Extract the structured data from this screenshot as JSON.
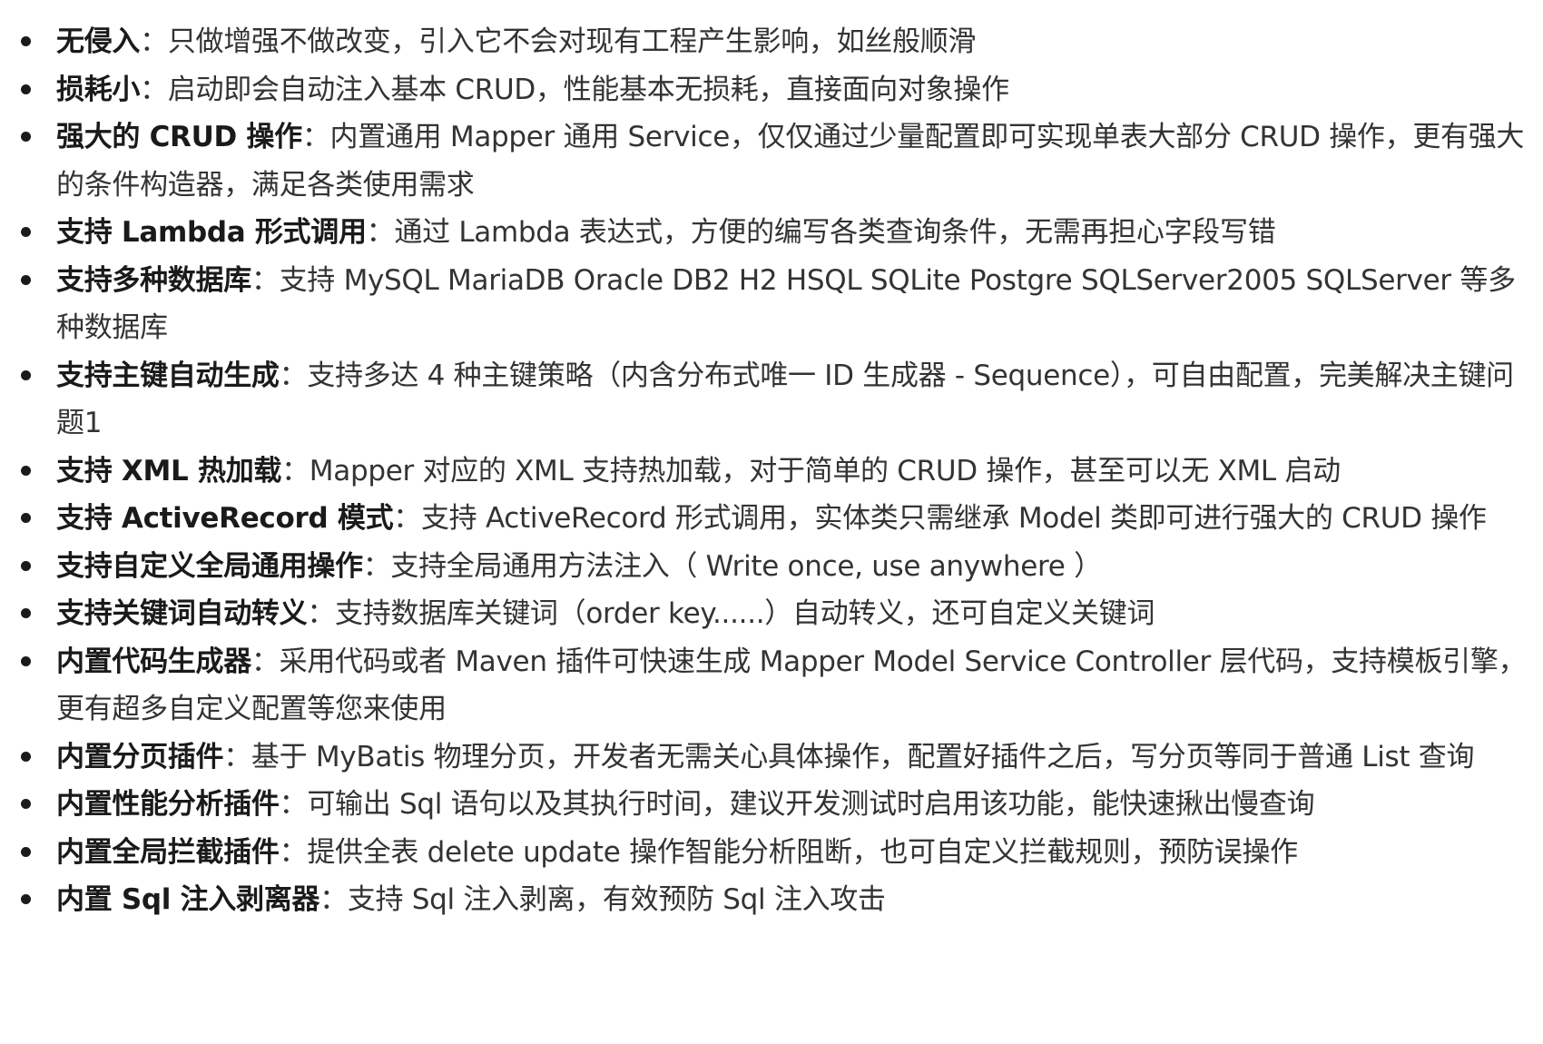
{
  "features": [
    {
      "title": "无侵入",
      "sep": "：",
      "desc": "只做增强不做改变，引入它不会对现有工程产生影响，如丝般顺滑"
    },
    {
      "title": "损耗小",
      "sep": "：",
      "desc": "启动即会自动注入基本 CRUD，性能基本无损耗，直接面向对象操作"
    },
    {
      "title": "强大的 CRUD 操作",
      "sep": "：",
      "desc": "内置通用 Mapper 通用 Service，仅仅通过少量配置即可实现单表大部分 CRUD 操作，更有强大的条件构造器，满足各类使用需求"
    },
    {
      "title": "支持 Lambda 形式调用",
      "sep": "：",
      "desc": "通过 Lambda 表达式，方便的编写各类查询条件，无需再担心字段写错"
    },
    {
      "title": "支持多种数据库",
      "sep": "：",
      "desc": "支持 MySQL MariaDB Oracle DB2 H2 HSQL SQLite Postgre SQLServer2005 SQLServer 等多种数据库"
    },
    {
      "title": "支持主键自动生成",
      "sep": "：",
      "desc": "支持多达 4 种主键策略（内含分布式唯一 ID 生成器 - Sequence），可自由配置，完美解决主键问题1"
    },
    {
      "title": "支持 XML 热加载",
      "sep": "：",
      "desc": "Mapper 对应的 XML 支持热加载，对于简单的 CRUD 操作，甚至可以无 XML 启动"
    },
    {
      "title": "支持 ActiveRecord 模式",
      "sep": "：",
      "desc": "支持 ActiveRecord 形式调用，实体类只需继承 Model 类即可进行强大的 CRUD 操作"
    },
    {
      "title": "支持自定义全局通用操作",
      "sep": "：",
      "desc": "支持全局通用方法注入（ Write once, use anywhere ）"
    },
    {
      "title": "支持关键词自动转义",
      "sep": "：",
      "desc": "支持数据库关键词（order key......）自动转义，还可自定义关键词"
    },
    {
      "title": "内置代码生成器",
      "sep": "：",
      "desc": "采用代码或者 Maven 插件可快速生成 Mapper Model Service Controller 层代码，支持模板引擎，更有超多自定义配置等您来使用"
    },
    {
      "title": "内置分页插件",
      "sep": "：",
      "desc": "基于 MyBatis 物理分页，开发者无需关心具体操作，配置好插件之后，写分页等同于普通 List 查询"
    },
    {
      "title": "内置性能分析插件",
      "sep": "：",
      "desc": "可输出 Sql 语句以及其执行时间，建议开发测试时启用该功能，能快速揪出慢查询"
    },
    {
      "title": "内置全局拦截插件",
      "sep": "：",
      "desc": "提供全表 delete update 操作智能分析阻断，也可自定义拦截规则，预防误操作"
    },
    {
      "title": "内置 Sql 注入剥离器",
      "sep": "：",
      "desc": "支持 Sql 注入剥离，有效预防 Sql 注入攻击"
    }
  ]
}
